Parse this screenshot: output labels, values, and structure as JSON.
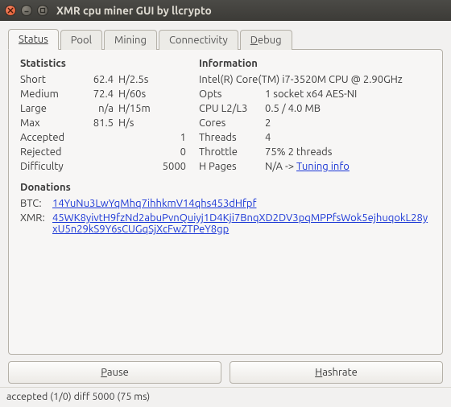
{
  "window": {
    "title": "XMR cpu miner GUI by llcrypto"
  },
  "tabs": {
    "status": "Status",
    "pool": "Pool",
    "mining": "Mining",
    "connectivity": "Connectivity",
    "debug": "Debug"
  },
  "stats": {
    "heading": "Statistics",
    "short": {
      "label": "Short",
      "value": "62.4",
      "unit": "H/2.5s"
    },
    "medium": {
      "label": "Medium",
      "value": "72.4",
      "unit": "H/60s"
    },
    "large": {
      "label": "Large",
      "value": "n/a",
      "unit": "H/15m"
    },
    "max": {
      "label": "Max",
      "value": "81.5",
      "unit": "H/s"
    },
    "accepted": {
      "label": "Accepted",
      "value": "1"
    },
    "rejected": {
      "label": "Rejected",
      "value": "0"
    },
    "difficulty": {
      "label": "Difficulty",
      "value": "5000"
    }
  },
  "info": {
    "heading": "Information",
    "cpu": "Intel(R) Core(TM) i7-3520M CPU @ 2.90GHz",
    "opts": {
      "label": "Opts",
      "value": "1 socket x64 AES-NI"
    },
    "cache": {
      "label": "CPU L2/L3",
      "value": "0.5 / 4.0 MB"
    },
    "cores": {
      "label": "Cores",
      "value": "2"
    },
    "threads": {
      "label": "Threads",
      "value": "4"
    },
    "throttle": {
      "label": "Throttle",
      "value": "75% 2 threads"
    },
    "hpages": {
      "label": "H Pages",
      "prefix": "N/A -> ",
      "link": "Tuning info"
    }
  },
  "donations": {
    "heading": "Donations",
    "btc": {
      "label": "BTC:",
      "addr": "14YuNu3LwYqMhq7ihhkmV14qhs453dHfpf"
    },
    "xmr": {
      "label": "XMR:",
      "addr": "45WK8yivtH9fzNd2abuPvnQuiyj1D4Kji7BnqXD2DV3pqMPPfsWok5ejhuqokL28yxU5n29kS9Y6sCUGqSjXcFwZTPeY8gp"
    }
  },
  "buttons": {
    "pause": "Pause",
    "hashrate": "Hashrate"
  },
  "statusbar": "accepted (1/0) diff 5000 (75 ms)"
}
